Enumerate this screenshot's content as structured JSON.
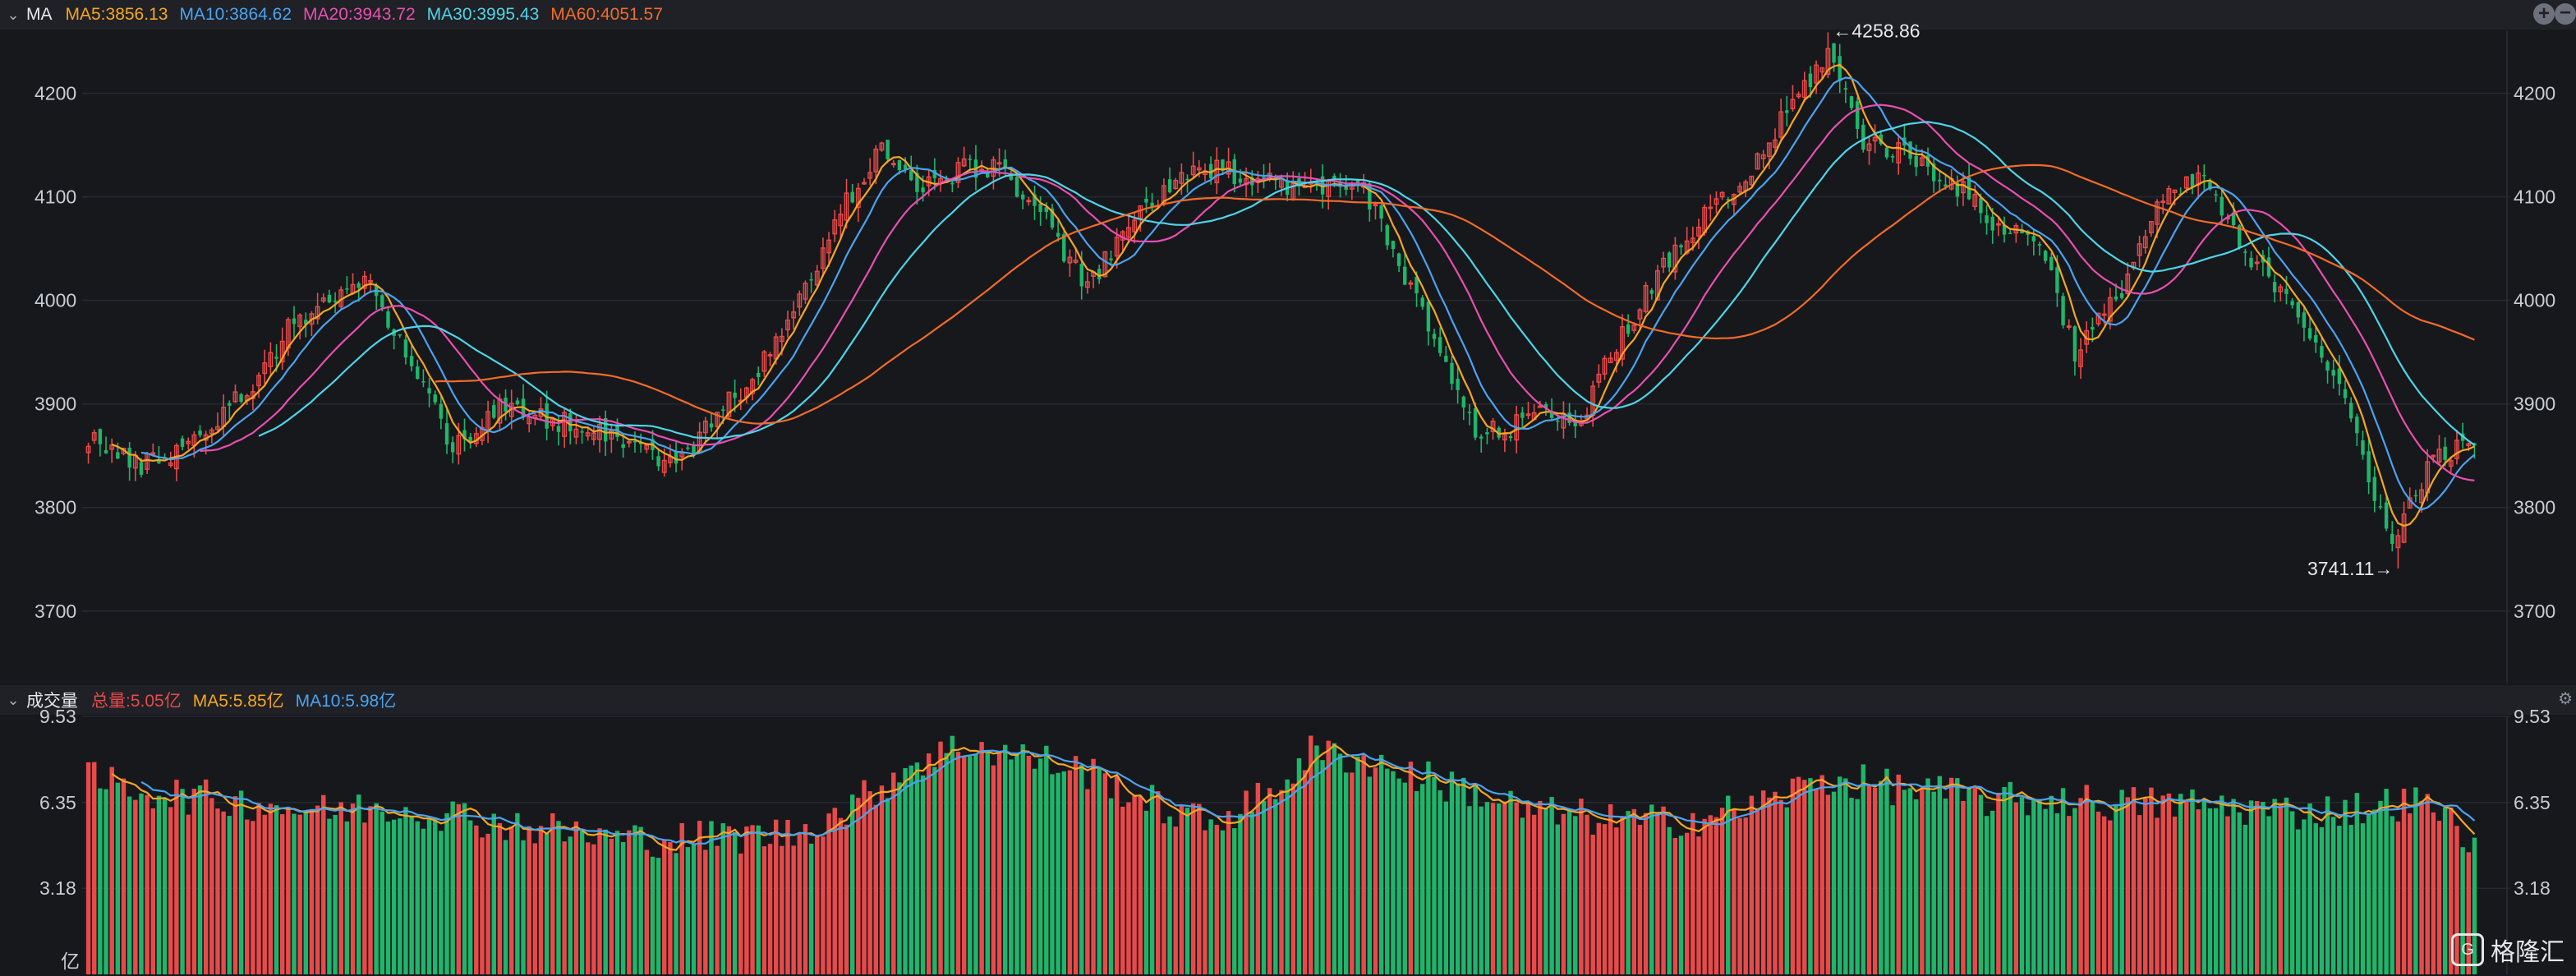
{
  "price_legend": {
    "title": "MA",
    "items": [
      {
        "label": "MA5:3856.13",
        "color": "#f5a623"
      },
      {
        "label": "MA10:3864.62",
        "color": "#4aa3f0"
      },
      {
        "label": "MA20:3943.72",
        "color": "#e84fb0"
      },
      {
        "label": "MA30:3995.43",
        "color": "#4fd4e8"
      },
      {
        "label": "MA60:4051.57",
        "color": "#f26b2a"
      }
    ]
  },
  "volume_legend": {
    "title": "成交量",
    "items": [
      {
        "label": "总量:5.05亿",
        "color": "#e84a4a"
      },
      {
        "label": "MA5:5.85亿",
        "color": "#f5a623"
      },
      {
        "label": "MA10:5.98亿",
        "color": "#4aa3f0"
      }
    ]
  },
  "controls": {
    "zoom_in": "+",
    "zoom_out": "−",
    "settings": "⚙"
  },
  "logo_text": "格隆汇",
  "colors": {
    "up": "#e84a4a",
    "down": "#1fb56b",
    "background": "#17181c"
  },
  "chart_data": [
    {
      "type": "candlestick",
      "ylim": [
        3630,
        4260
      ],
      "yticks": [
        "3700",
        "3800",
        "3900",
        "4000",
        "4100",
        "4200"
      ],
      "max_label": "←4258.86",
      "min_label": "3741.11→",
      "high": 4258.86,
      "low": 3741.11,
      "waypoints": [
        [
          0,
          3870
        ],
        [
          8,
          3840
        ],
        [
          15,
          3855
        ],
        [
          22,
          3885
        ],
        [
          28,
          3920
        ],
        [
          35,
          3980
        ],
        [
          42,
          4005
        ],
        [
          48,
          4015
        ],
        [
          55,
          3940
        ],
        [
          62,
          3860
        ],
        [
          70,
          3895
        ],
        [
          78,
          3885
        ],
        [
          85,
          3880
        ],
        [
          92,
          3865
        ],
        [
          100,
          3840
        ],
        [
          108,
          3895
        ],
        [
          115,
          3940
        ],
        [
          122,
          4010
        ],
        [
          128,
          4085
        ],
        [
          135,
          4150
        ],
        [
          141,
          4105
        ],
        [
          148,
          4125
        ],
        [
          155,
          4130
        ],
        [
          162,
          4085
        ],
        [
          170,
          4010
        ],
        [
          178,
          4080
        ],
        [
          185,
          4115
        ],
        [
          192,
          4125
        ],
        [
          200,
          4120
        ],
        [
          208,
          4105
        ],
        [
          216,
          4120
        ],
        [
          222,
          4045
        ],
        [
          230,
          3950
        ],
        [
          236,
          3870
        ],
        [
          242,
          3875
        ],
        [
          248,
          3900
        ],
        [
          254,
          3880
        ],
        [
          260,
          3960
        ],
        [
          268,
          4030
        ],
        [
          275,
          4080
        ],
        [
          282,
          4115
        ],
        [
          290,
          4190
        ],
        [
          296,
          4240
        ],
        [
          302,
          4155
        ],
        [
          310,
          4140
        ],
        [
          318,
          4110
        ],
        [
          325,
          4070
        ],
        [
          332,
          4060
        ],
        [
          338,
          3950
        ],
        [
          345,
          4000
        ],
        [
          352,
          4090
        ],
        [
          360,
          4120
        ],
        [
          367,
          4040
        ],
        [
          374,
          4010
        ],
        [
          380,
          3950
        ],
        [
          386,
          3870
        ],
        [
          392,
          3760
        ],
        [
          396,
          3820
        ],
        [
          400,
          3850
        ],
        [
          406,
          3860
        ]
      ],
      "ma_lines": [
        {
          "name": "MA5",
          "color": "#f5a623",
          "period": 5
        },
        {
          "name": "MA10",
          "color": "#4aa3f0",
          "period": 10
        },
        {
          "name": "MA20",
          "color": "#e84fb0",
          "period": 20
        },
        {
          "name": "MA30",
          "color": "#4fd4e8",
          "period": 30
        },
        {
          "name": "MA60",
          "color": "#f26b2a",
          "period": 60
        }
      ]
    },
    {
      "type": "bar",
      "ylim": [
        0,
        9.53
      ],
      "yticks": [
        "9.53",
        "6.35",
        "3.18"
      ],
      "unit_label": "亿",
      "waypoints": [
        [
          0,
          7.2
        ],
        [
          10,
          6.8
        ],
        [
          20,
          6.5
        ],
        [
          30,
          6.3
        ],
        [
          40,
          6.0
        ],
        [
          50,
          6.2
        ],
        [
          60,
          6.0
        ],
        [
          70,
          5.6
        ],
        [
          80,
          5.3
        ],
        [
          90,
          5.0
        ],
        [
          100,
          5.0
        ],
        [
          110,
          5.1
        ],
        [
          120,
          5.2
        ],
        [
          130,
          6.2
        ],
        [
          140,
          7.8
        ],
        [
          150,
          8.5
        ],
        [
          160,
          8.0
        ],
        [
          170,
          7.5
        ],
        [
          180,
          6.4
        ],
        [
          190,
          5.6
        ],
        [
          200,
          6.5
        ],
        [
          208,
          8.2
        ],
        [
          216,
          8.0
        ],
        [
          225,
          7.4
        ],
        [
          235,
          6.8
        ],
        [
          245,
          6.0
        ],
        [
          255,
          5.8
        ],
        [
          265,
          5.6
        ],
        [
          275,
          5.8
        ],
        [
          285,
          6.3
        ],
        [
          295,
          7.2
        ],
        [
          305,
          7.0
        ],
        [
          315,
          6.7
        ],
        [
          325,
          6.4
        ],
        [
          335,
          6.5
        ],
        [
          345,
          6.3
        ],
        [
          355,
          6.3
        ],
        [
          365,
          6.2
        ],
        [
          375,
          6.0
        ],
        [
          385,
          6.1
        ],
        [
          395,
          6.4
        ],
        [
          400,
          6.0
        ],
        [
          406,
          5.05
        ]
      ],
      "ma_lines": [
        {
          "name": "MA5",
          "color": "#f5a623",
          "period": 5
        },
        {
          "name": "MA10",
          "color": "#4aa3f0",
          "period": 10
        }
      ]
    }
  ]
}
